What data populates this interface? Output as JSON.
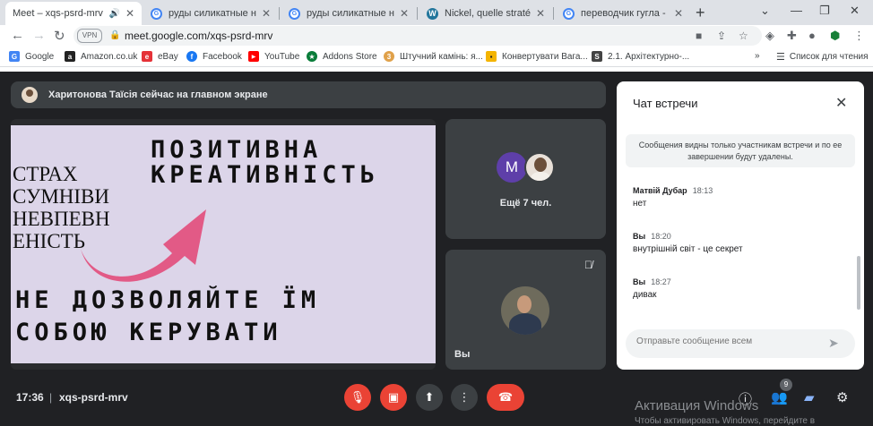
{
  "tabs": [
    {
      "label": "Meet – xqs-psrd-mrv",
      "favicon": "meet-icon"
    },
    {
      "label": "руды силикатные никел",
      "favicon": "google-icon"
    },
    {
      "label": "руды силикатные никел",
      "favicon": "google-icon"
    },
    {
      "label": "Nickel, quelle stratégie ?",
      "favicon": "wordpress-icon"
    },
    {
      "label": "переводчик гугла - Поиск",
      "favicon": "google-icon"
    }
  ],
  "omnibox": {
    "vpn_label": "VPN",
    "url": "meet.google.com/xqs-psrd-mrv"
  },
  "bookmarks": [
    {
      "label": "Google",
      "color": "#4285f4",
      "glyph": "G"
    },
    {
      "label": "Amazon.co.uk",
      "color": "#222222",
      "glyph": "a"
    },
    {
      "label": "eBay",
      "color": "#e53238",
      "glyph": "e"
    },
    {
      "label": "Facebook",
      "color": "#1877f2",
      "glyph": "f"
    },
    {
      "label": "YouTube",
      "color": "#ff0000",
      "glyph": "▶"
    },
    {
      "label": "Addons Store",
      "color": "#0a7d3a",
      "glyph": "★"
    },
    {
      "label": "Штучний камінь: я...",
      "color": "#e0a14a",
      "glyph": "3"
    },
    {
      "label": "Конвертувати Вага...",
      "color": "#f4b400",
      "glyph": "▪"
    },
    {
      "label": "2.1. Архітектурно-...",
      "color": "#444444",
      "glyph": "S"
    }
  ],
  "reading_list": "Список для чтения",
  "banner": {
    "text": "Харитонова Таїсія сейчас на главном экране"
  },
  "slide": {
    "top_lines": [
      "ПОЗИТИВНА",
      "КРЕАТИВНІСТЬ"
    ],
    "left_lines": [
      "СТРАХ",
      "СУМНІВИ",
      "НЕВПЕВН",
      "ЕНІСТЬ"
    ],
    "bottom_lines": [
      "НЕ ДОЗВОЛЯЙТЕ ЇМ",
      "СОБОЮ КЕРУВАТИ"
    ],
    "arrow_color": "#e25a86"
  },
  "tiles": {
    "group_initial": "M",
    "group_label": "Ещё 7 чел.",
    "self_label": "Вы"
  },
  "chat": {
    "title": "Чат встречи",
    "notice": "Сообщения видны только участникам встречи и по ее завершении будут удалены.",
    "messages": [
      {
        "author": "Матвій Дубар",
        "time": "18:13",
        "text": "нет"
      },
      {
        "author": "Вы",
        "time": "18:20",
        "text": "внутрішній світ - це секрет"
      },
      {
        "author": "Вы",
        "time": "18:27",
        "text": "дивак"
      }
    ],
    "input_placeholder": "Отправьте сообщение всем"
  },
  "bottom": {
    "clock": "17:36",
    "separator": "|",
    "meeting_code": "xqs-psrd-mrv",
    "participants_count": "9"
  },
  "watermark": {
    "line1": "Активация Windows",
    "line2": "Чтобы активировать Windows, перейдите в"
  },
  "colors": {
    "hangup": "#ea4335",
    "chat_accent": "#1a73e8"
  }
}
